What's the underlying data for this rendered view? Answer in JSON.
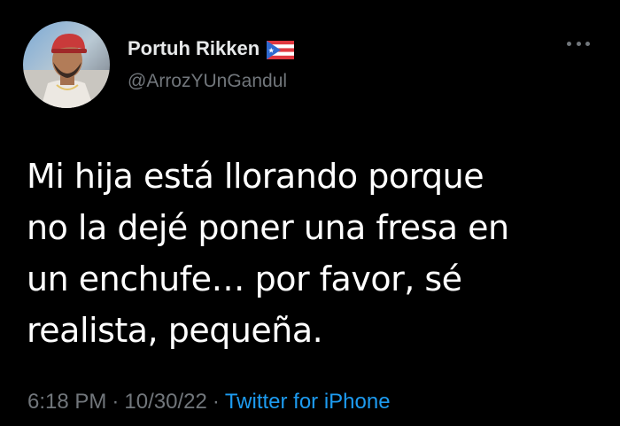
{
  "author": {
    "display_name": "Portuh Rikken",
    "handle": "@ArrozYUnGandul",
    "flag_icon": "puerto-rico-flag-icon",
    "avatar_icon": "profile-photo"
  },
  "tweet": {
    "text_lines": [
      "Mi hija está llorando porque",
      "no la dejé poner una fresa en",
      "un enchufe… por favor, sé",
      "realista, pequeña."
    ]
  },
  "meta": {
    "time": "6:18 PM",
    "separator_1": "·",
    "date": "10/30/22",
    "separator_2": "·",
    "source": "Twitter for iPhone"
  },
  "colors": {
    "background": "#000000",
    "primary_text": "#e7e9ea",
    "secondary_text": "#71767b",
    "link": "#1d9bf0"
  },
  "icons": {
    "more": "more-horizontal-icon"
  }
}
